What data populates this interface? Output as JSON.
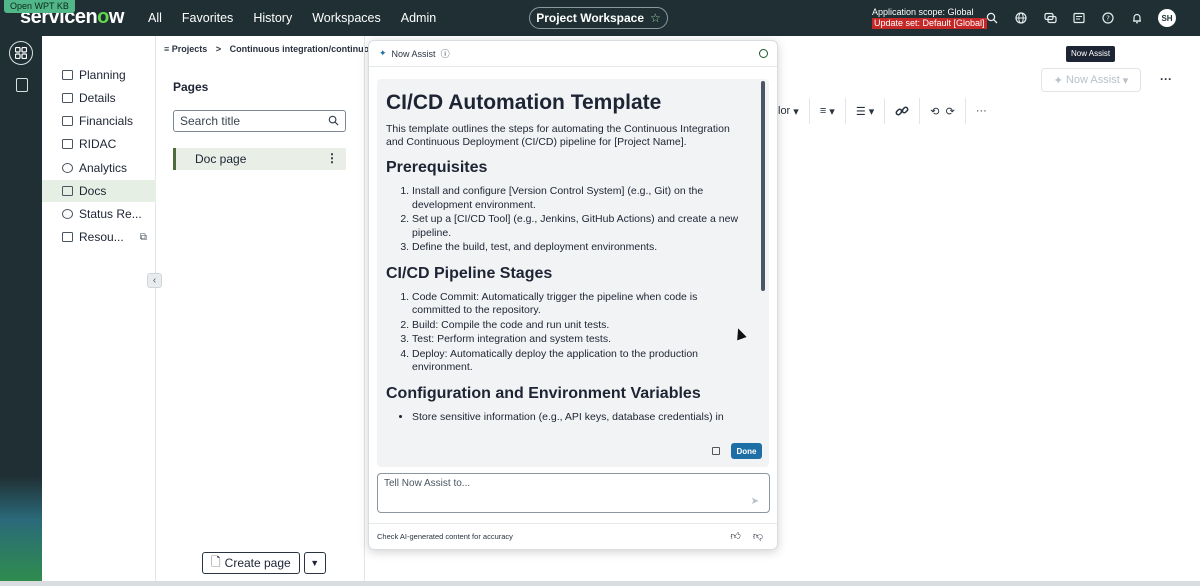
{
  "kb_badge": "Open WPT KB",
  "brand": {
    "logo_left": "servicen",
    "logo_o": "o",
    "logo_right": "w"
  },
  "nav": {
    "all": "All",
    "favorites": "Favorites",
    "history": "History",
    "workspaces": "Workspaces",
    "admin": "Admin"
  },
  "workspace_pill": {
    "label": "Project Workspace",
    "star": "☆"
  },
  "scope": {
    "line1": "Application scope: Global",
    "line2": "Update set: Default [Global]"
  },
  "user": {
    "initials": "SH"
  },
  "sidenav": {
    "items": [
      {
        "label": "Planning",
        "icon": "planning-icon"
      },
      {
        "label": "Details",
        "icon": "details-icon"
      },
      {
        "label": "Financials",
        "icon": "financials-icon"
      },
      {
        "label": "RIDAC",
        "icon": "ridac-icon"
      },
      {
        "label": "Analytics",
        "icon": "analytics-icon"
      },
      {
        "label": "Docs",
        "icon": "docs-icon"
      },
      {
        "label": "Status Re...",
        "icon": "status-icon"
      },
      {
        "label": "Resou...",
        "icon": "resources-icon"
      }
    ],
    "active": "Docs"
  },
  "breadcrumb": {
    "root": "Projects",
    "separator": ">",
    "current": "Continuous integration/continuous de"
  },
  "pages": {
    "title": "Pages",
    "search_placeholder": "Search title",
    "doc_item": "Doc page",
    "create_label": "Create page"
  },
  "toolbar": {
    "color_label": "lor",
    "more": "···"
  },
  "now_assist_button": "Now Assist",
  "tooltip": "Now Assist",
  "assist": {
    "header": "Now Assist",
    "prompt_placeholder": "Tell Now Assist to...",
    "done": "Done",
    "footer": "Check AI-generated content for accuracy",
    "doc": {
      "title": "CI/CD Automation Template",
      "intro": "This template outlines the steps for automating the Continuous Integration and Continuous Deployment (CI/CD) pipeline for [Project Name].",
      "sections": [
        {
          "heading": "Prerequisites",
          "type": "ol",
          "items": [
            "Install and configure [Version Control System] (e.g., Git) on the development environment.",
            "Set up a [CI/CD Tool] (e.g., Jenkins, GitHub Actions) and create a new pipeline.",
            "Define the build, test, and deployment environments."
          ]
        },
        {
          "heading": "CI/CD Pipeline Stages",
          "type": "ol",
          "items": [
            "Code Commit: Automatically trigger the pipeline when code is committed to the repository.",
            "Build: Compile the code and run unit tests.",
            "Test: Perform integration and system tests.",
            "Deploy: Automatically deploy the application to the production environment."
          ]
        },
        {
          "heading": "Configuration and Environment Variables",
          "type": "ul",
          "items": [
            "Store sensitive information (e.g., API keys, database credentials) in"
          ]
        }
      ]
    }
  }
}
